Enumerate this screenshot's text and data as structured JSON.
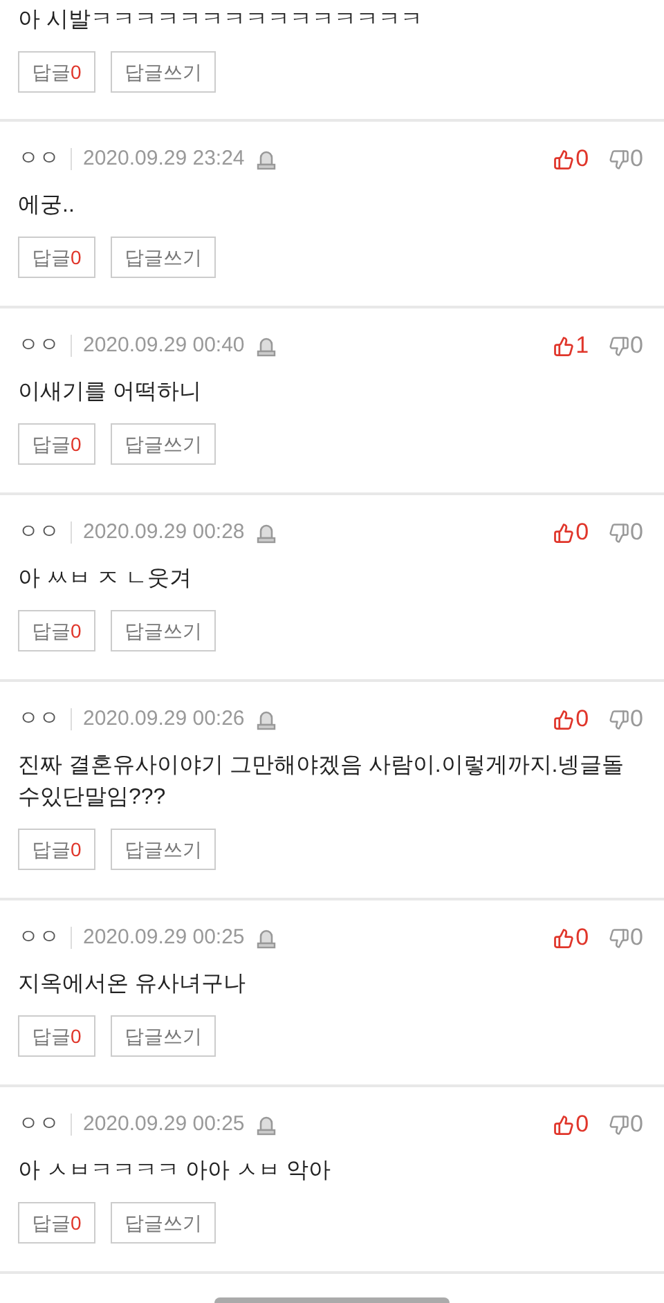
{
  "comments": [
    {
      "text": "아 시발ㅋㅋㅋㅋㅋㅋㅋㅋㅋㅋㅋㅋㅋㅋㅋ",
      "reply_label": "답글",
      "reply_count": "0",
      "write_label": "답글쓰기"
    },
    {
      "author": "ㅇㅇ",
      "date": "2020.09.29 23:24",
      "likes": "0",
      "dislikes": "0",
      "text": "에궁..",
      "reply_label": "답글",
      "reply_count": "0",
      "write_label": "답글쓰기"
    },
    {
      "author": "ㅇㅇ",
      "date": "2020.09.29 00:40",
      "likes": "1",
      "dislikes": "0",
      "text": "이새기를 어떡하니",
      "reply_label": "답글",
      "reply_count": "0",
      "write_label": "답글쓰기"
    },
    {
      "author": "ㅇㅇ",
      "date": "2020.09.29 00:28",
      "likes": "0",
      "dislikes": "0",
      "text": "아 ㅆㅂ ㅈ ㄴ웃겨",
      "reply_label": "답글",
      "reply_count": "0",
      "write_label": "답글쓰기"
    },
    {
      "author": "ㅇㅇ",
      "date": "2020.09.29 00:26",
      "likes": "0",
      "dislikes": "0",
      "text": "진짜 결혼유사이야기 그만해야겠음 사람이.이렇게까지.넹글돌수있단말임???",
      "reply_label": "답글",
      "reply_count": "0",
      "write_label": "답글쓰기"
    },
    {
      "author": "ㅇㅇ",
      "date": "2020.09.29 00:25",
      "likes": "0",
      "dislikes": "0",
      "text": "지옥에서온 유사녀구나",
      "reply_label": "답글",
      "reply_count": "0",
      "write_label": "답글쓰기"
    },
    {
      "author": "ㅇㅇ",
      "date": "2020.09.29 00:25",
      "likes": "0",
      "dislikes": "0",
      "text": "아 ㅅㅂㅋㅋㅋㅋ 아아 ㅅㅂ 악아",
      "reply_label": "답글",
      "reply_count": "0",
      "write_label": "답글쓰기"
    }
  ]
}
